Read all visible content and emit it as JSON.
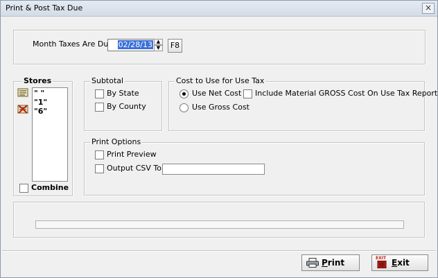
{
  "window": {
    "title": "Print & Post Tax Due",
    "close_glyph": "×"
  },
  "month_due": {
    "label": "Month Taxes Are Due",
    "value": "02/28/13",
    "lookup_button": "F8",
    "spin_up": "▲",
    "spin_down": "▼"
  },
  "stores": {
    "label": "Stores",
    "items": [
      "\" \"",
      "\"1\"",
      "\"6\""
    ],
    "combine_label": "Combine",
    "combine_checked": false
  },
  "subtotal": {
    "label": "Subtotal",
    "options": [
      {
        "label": "By State",
        "checked": false
      },
      {
        "label": "By County",
        "checked": false
      }
    ]
  },
  "cost": {
    "label": "Cost to Use for Use Tax",
    "net_cost_label": "Use Net Cost",
    "gross_cost_label": "Use Gross Cost",
    "selected": "Use Net Cost",
    "include_material_label": "Include Material GROSS Cost On Use Tax Report",
    "include_material_checked": false
  },
  "print_options": {
    "label": "Print Options",
    "print_preview_label": "Print Preview",
    "print_preview_checked": false,
    "output_csv_label": "Output CSV To:",
    "output_csv_checked": false,
    "output_csv_path": ""
  },
  "progress": {
    "value_percent": 0
  },
  "buttons": {
    "print": {
      "label_first": "P",
      "label_rest": "rint",
      "icon": "printer-icon"
    },
    "exit": {
      "label_first": "E",
      "label_rest": "xit",
      "icon": "exit-door-icon",
      "icon_text": "EXIT"
    }
  },
  "colors": {
    "selection": "#3a6fd8",
    "exit_icon": "#c0201a"
  }
}
